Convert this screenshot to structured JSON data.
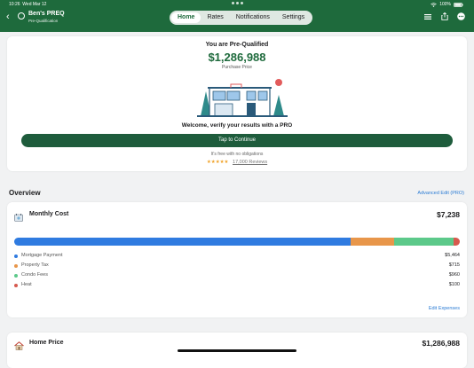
{
  "status_bar": {
    "time": "10:26",
    "date": "Wed Mar 12",
    "battery": "100%"
  },
  "header": {
    "title": "Ben's PREQ",
    "subtitle": "Pre-Qualification"
  },
  "tabs": [
    {
      "label": "Home",
      "active": true
    },
    {
      "label": "Rates",
      "active": false
    },
    {
      "label": "Notifications",
      "active": false
    },
    {
      "label": "Settings",
      "active": false
    }
  ],
  "prequal": {
    "heading": "You are Pre-Qualified",
    "amount": "$1,286,988",
    "amount_label": "Purchase Price",
    "welcome": "Welcome, verify your results with a PRO",
    "cta_label": "Tap to Continue",
    "free_note": "It's free with no obligations",
    "stars": "★★★★★",
    "reviews": "17,000 Reviews"
  },
  "overview": {
    "title": "Overview",
    "advanced_edit": "Advanced Edit (PRO)"
  },
  "monthly_cost": {
    "title": "Monthly Cost",
    "total": "$7,238",
    "items": [
      {
        "label": "Mortgage Payment",
        "value": "$5,464",
        "amount": 5464,
        "color": "#2f7be0"
      },
      {
        "label": "Property Tax",
        "value": "$715",
        "amount": 715,
        "color": "#e8964a"
      },
      {
        "label": "Condo Fees",
        "value": "$960",
        "amount": 960,
        "color": "#5cc98a"
      },
      {
        "label": "Heat",
        "value": "$100",
        "amount": 100,
        "color": "#d65a4e"
      }
    ],
    "edit_label": "Edit Expenses"
  },
  "home_price": {
    "title": "Home Price",
    "value": "$1,286,988"
  },
  "colors": {
    "header": "#1e6a3c",
    "cta": "#1e5c3c",
    "link": "#2a7bd4",
    "star": "#f0a32a"
  }
}
